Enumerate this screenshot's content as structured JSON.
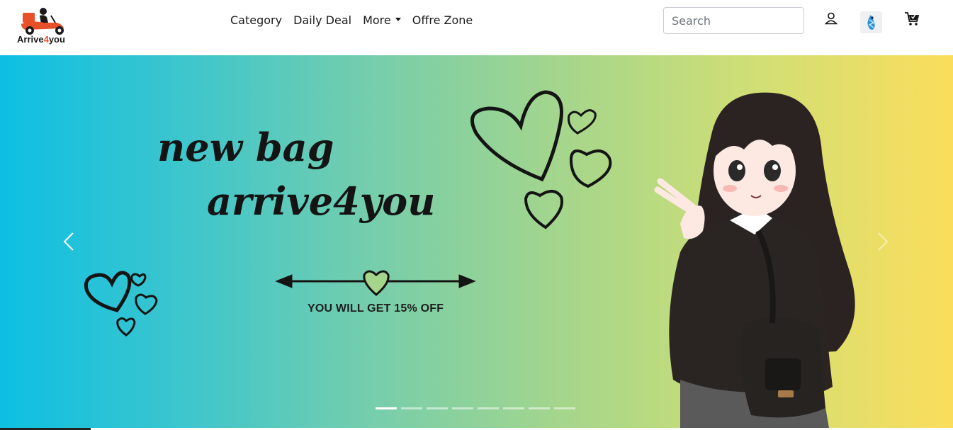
{
  "brand": {
    "name_part1": "Arrive",
    "name_part2": "4",
    "name_part3": "you",
    "logo_icon": "scooter-delivery-logo"
  },
  "nav": {
    "items": [
      {
        "label": "Category"
      },
      {
        "label": "Daily Deal"
      },
      {
        "label": "More",
        "dropdown": true
      },
      {
        "label": "Offre Zone"
      }
    ]
  },
  "search": {
    "placeholder": "Search",
    "value": ""
  },
  "header_icons": {
    "user": "user-icon",
    "badge": "app-badge-icon",
    "cart": "cart-icon"
  },
  "carousel": {
    "slide_title_line1": "new bag",
    "slide_title_line2": "arrive4you",
    "slide_subtitle": "YOU WILL GET 15% OFF",
    "prev_icon": "chevron-left-icon",
    "next_icon": "chevron-right-icon",
    "indicator_count": 8,
    "active_index": 0
  },
  "colors": {
    "gradient_start": "#0dbfe3",
    "gradient_end": "#fbdd5c",
    "brand_accent": "#e8502a"
  }
}
